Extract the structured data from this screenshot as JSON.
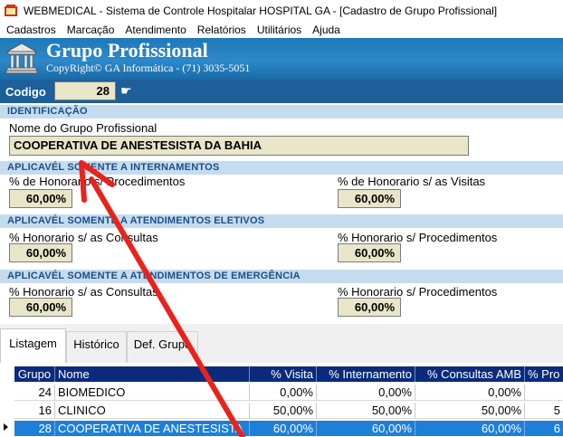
{
  "window": {
    "title": "WEBMEDICAL - Sistema de Controle Hospitalar HOSPITAL GA - [Cadastro de Grupo Profissional]"
  },
  "menu": {
    "items": [
      "Cadastros",
      "Marcação",
      "Atendimento",
      "Relatórios",
      "Utilitários",
      "Ajuda"
    ]
  },
  "header": {
    "title": "Grupo Profissional",
    "copyright": "CopyRight© GA Informática - (71) 3035-5051"
  },
  "code": {
    "label": "Codigo",
    "value": "28"
  },
  "identificacao": {
    "section_title": "IDENTIFICAÇÃO",
    "name_label": "Nome do Grupo Profissional",
    "name_value": "COOPERATIVA DE ANESTESISTA DA BAHIA"
  },
  "internamentos": {
    "section_title": "APLICAVÉL SOMENTE A INTERNAMENTOS",
    "proc_label": "% de Honorario s/ Procedimentos",
    "proc_value": "60,00%",
    "visitas_label": "% de Honorario s/ as Visitas",
    "visitas_value": "60,00%"
  },
  "eletivos": {
    "section_title": "APLICAVÉL SOMENTE A ATENDIMENTOS ELETIVOS",
    "consultas_label": "% Honorario s/ as Consultas",
    "consultas_value": "60,00%",
    "proc_label": "% Honorario s/ Procedimentos",
    "proc_value": "60,00%"
  },
  "emergencia": {
    "section_title": "APLICAVÉL SOMENTE A ATENDIMENTOS DE EMERGÊNCIA",
    "consultas_label": "% Honorario s/ as Consultas",
    "consultas_value": "60,00%",
    "proc_label": "% Honorario s/ Procedimentos",
    "proc_value": "60,00%"
  },
  "tabs": [
    "Listagem",
    "Histórico",
    "Def. Grupo"
  ],
  "grid": {
    "columns": [
      "Grupo",
      "Nome",
      "% Visita",
      "% Internamento",
      "% Consultas AMB",
      "% Pro"
    ],
    "rows": [
      [
        "24",
        "BIOMEDICO",
        "0,00%",
        "0,00%",
        "0,00%",
        ""
      ],
      [
        "16",
        "CLINICO",
        "50,00%",
        "50,00%",
        "50,00%",
        "5"
      ],
      [
        "28",
        "COOPERATIVA DE ANESTESISTA",
        "60,00%",
        "60,00%",
        "60,00%",
        "6"
      ]
    ]
  },
  "colors": {
    "header_blue": "#2d89c9",
    "code_bar": "#1c5f9a",
    "section_bg": "#c5dcef",
    "input_bg": "#e9e5c8",
    "grid_header": "#0b2b7a",
    "selected_row": "#1e7fd8",
    "annotation_arrow": "#e8231c"
  },
  "icons": {
    "app": "webmedical-app-icon",
    "logo": "building-columns-icon",
    "pointer": "pointing-hand-icon"
  }
}
